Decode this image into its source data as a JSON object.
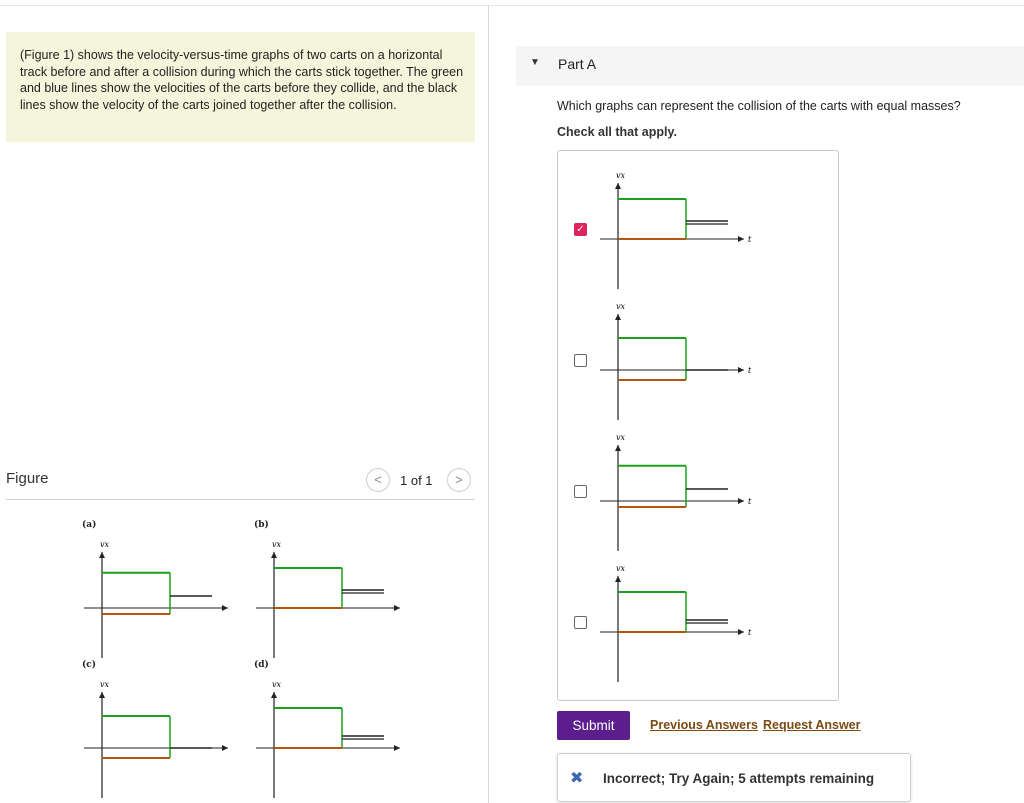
{
  "intro": {
    "figure_link": "Figure 1",
    "text_before": "(",
    "text_after": ") shows the velocity-versus-time graphs of two carts on a horizontal track before and after a collision during which the carts stick together. The green and blue lines show the velocities of the carts before they collide, and the black lines show the velocity of the carts joined together after the collision."
  },
  "figure": {
    "title": "Figure",
    "counter": "1 of 1",
    "prev_icon": "chevron-left-icon",
    "next_icon": "chevron-right-icon",
    "panels": [
      {
        "letter": "(a)",
        "variant": "a"
      },
      {
        "letter": "(b)",
        "variant": "b"
      },
      {
        "letter": "(c)",
        "variant": "c"
      },
      {
        "letter": "(d)",
        "variant": "d"
      }
    ],
    "axis_y": "vx",
    "axis_x": "t"
  },
  "part": {
    "title": "Part A",
    "question": "Which graphs can represent the collision of the carts with equal masses?",
    "instruction": "Check all that apply.",
    "options": [
      {
        "variant": "b",
        "checked": true
      },
      {
        "variant": "c",
        "checked": false
      },
      {
        "variant": "a",
        "checked": false
      },
      {
        "variant": "d",
        "checked": false
      }
    ]
  },
  "actions": {
    "submit": "Submit",
    "previous_answers": "Previous Answers",
    "request_answer": "Request Answer"
  },
  "feedback": {
    "icon": "x-mark-icon",
    "icon_glyph": "✖",
    "text": "Incorrect; Try Again; 5 attempts remaining"
  },
  "colors": {
    "green": "#1aa31a",
    "orange": "#b5560f",
    "black": "#222222",
    "submit": "#5c1e8c",
    "checkbox_checked": "#e0245e",
    "intro_bg": "#f5f5dc"
  }
}
